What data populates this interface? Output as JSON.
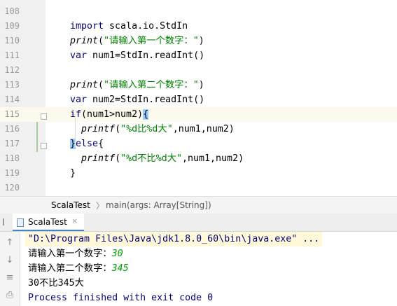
{
  "editor": {
    "lines": [
      {
        "num": "108",
        "parts": []
      },
      {
        "num": "109",
        "parts": [
          {
            "t": "import ",
            "c": "kw"
          },
          {
            "t": "scala.io.StdIn",
            "c": ""
          }
        ]
      },
      {
        "num": "110",
        "parts": [
          {
            "t": "print",
            "c": "fn"
          },
          {
            "t": "(",
            "c": ""
          },
          {
            "t": "\"请输入第一个数字：\"",
            "c": "str"
          },
          {
            "t": ")",
            "c": ""
          }
        ]
      },
      {
        "num": "111",
        "parts": [
          {
            "t": "var ",
            "c": "kw"
          },
          {
            "t": "num1=StdIn.readInt()",
            "c": ""
          }
        ]
      },
      {
        "num": "112",
        "parts": []
      },
      {
        "num": "113",
        "parts": [
          {
            "t": "print",
            "c": "fn"
          },
          {
            "t": "(",
            "c": ""
          },
          {
            "t": "\"请输入第二个数字：\"",
            "c": "str"
          },
          {
            "t": ")",
            "c": ""
          }
        ]
      },
      {
        "num": "114",
        "parts": [
          {
            "t": "var ",
            "c": "kw"
          },
          {
            "t": "num2=StdIn.readInt()",
            "c": ""
          }
        ]
      },
      {
        "num": "115",
        "parts": [
          {
            "t": "if",
            "c": "kw"
          },
          {
            "t": "(num1>num2)",
            "c": ""
          },
          {
            "t": "{",
            "c": "brace-hl"
          }
        ]
      },
      {
        "num": "116",
        "parts": [
          {
            "t": "  ",
            "c": ""
          },
          {
            "t": "printf",
            "c": "fn"
          },
          {
            "t": "(",
            "c": ""
          },
          {
            "t": "\"%d比%d大\"",
            "c": "str"
          },
          {
            "t": ",num1,num2)",
            "c": ""
          }
        ]
      },
      {
        "num": "117",
        "parts": [
          {
            "t": "}",
            "c": "brace-hl"
          },
          {
            "t": "else",
            "c": "kw"
          },
          {
            "t": "{",
            "c": ""
          }
        ]
      },
      {
        "num": "118",
        "parts": [
          {
            "t": "  ",
            "c": ""
          },
          {
            "t": "printf",
            "c": "fn"
          },
          {
            "t": "(",
            "c": ""
          },
          {
            "t": "\"%d不比%d大\"",
            "c": "str"
          },
          {
            "t": ",num1,num2)",
            "c": ""
          }
        ]
      },
      {
        "num": "119",
        "parts": [
          {
            "t": "}",
            "c": ""
          }
        ]
      },
      {
        "num": "120",
        "parts": []
      }
    ],
    "current_line": "115"
  },
  "breadcrumbs": {
    "items": [
      "ScalaTest",
      "main(args: Array[String])"
    ]
  },
  "run_panel": {
    "tab_label": "ScalaTest",
    "close_glyph": "×",
    "toolbar_icons": [
      "arrow-up-icon",
      "arrow-down-icon",
      "soft-wrap-icon",
      "print-icon"
    ],
    "toolbar_glyphs": [
      "↑",
      "↓",
      "≡",
      "⎙"
    ]
  },
  "console": {
    "command": "\"D:\\Program Files\\Java\\jdk1.8.0_60\\bin\\java.exe\" ...",
    "prompt1": "请输入第一个数字：",
    "input1": "30",
    "prompt2": "请输入第二个数字：",
    "input2": "345",
    "result": "30不比345大",
    "exit_message": "Process finished with exit code 0"
  },
  "colors": {
    "keyword": "#000080",
    "string": "#008000",
    "user_input": "#00a000",
    "current_line": "#fcfaed",
    "brace_match": "#99ccff"
  }
}
